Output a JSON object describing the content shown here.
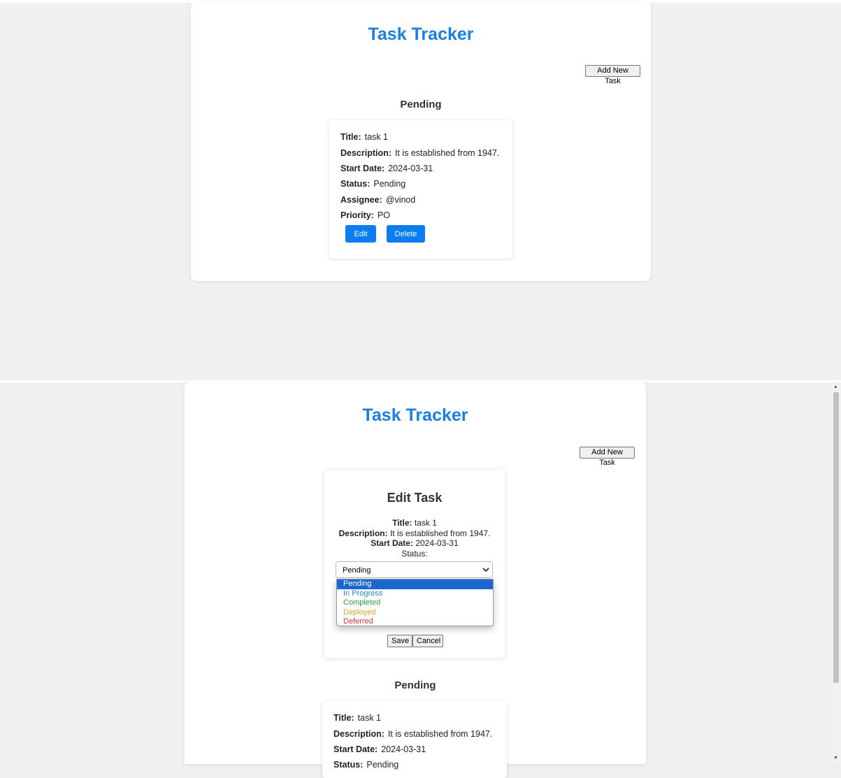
{
  "app": {
    "title": "Task Tracker",
    "add_task_label": "Add New Task"
  },
  "column": {
    "heading": "Pending"
  },
  "labels": {
    "title": "Title:",
    "description": "Description:",
    "start_date": "Start Date:",
    "status": "Status:",
    "assignee": "Assignee:",
    "priority": "Priority:"
  },
  "task": {
    "title": "task 1",
    "description": "It is established from 1947.",
    "start_date": "2024-03-31",
    "status": "Pending",
    "assignee": "@vinod",
    "priority": "PO",
    "edit_label": "Edit",
    "delete_label": "Delete"
  },
  "edit_form": {
    "heading": "Edit Task",
    "status_label": "Status:",
    "selected_status": "Pending",
    "options": [
      {
        "label": "Pending",
        "color": "#ffffff"
      },
      {
        "label": "In Progress",
        "color": "#1a8ad0"
      },
      {
        "label": "Completed",
        "color": "#2e9e3e"
      },
      {
        "label": "Deployed",
        "color": "#e8a317"
      },
      {
        "label": "Deferred",
        "color": "#d93a3a"
      }
    ],
    "save_label": "Save",
    "cancel_label": "Cancel"
  },
  "colors": {
    "accent": "#1a7fe0",
    "button": "#0a7ef0",
    "background": "#f0f0f0"
  },
  "icons": {
    "select_chevron": "chevron-down-icon",
    "scroll_up": "triangle-up-icon",
    "scroll_down": "triangle-down-icon"
  }
}
